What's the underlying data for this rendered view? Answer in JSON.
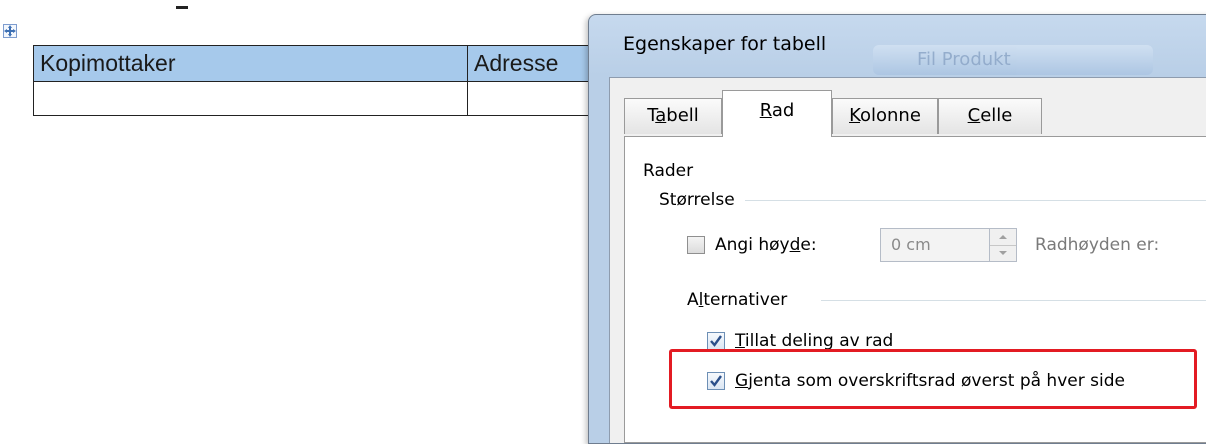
{
  "document": {
    "table": {
      "header": [
        "Kopimottaker",
        "Adresse"
      ],
      "rows": [
        [
          "",
          ""
        ]
      ]
    }
  },
  "dialog": {
    "title": "Egenskaper for tabell",
    "background_tab": "Fil  Produkt",
    "tabs": [
      {
        "pre": "T",
        "u": "a",
        "post": "bell",
        "active": false
      },
      {
        "pre": "",
        "u": "R",
        "post": "ad",
        "active": true
      },
      {
        "pre": "",
        "u": "K",
        "post": "olonne",
        "active": false
      },
      {
        "pre": "",
        "u": "C",
        "post": "elle",
        "active": false
      }
    ],
    "section_title": "Rader",
    "size_group": {
      "label": "Størrelse",
      "height_checkbox": {
        "pre": "Angi høy",
        "u": "d",
        "post": "e:",
        "checked": false
      },
      "height_value": "0 cm",
      "row_height_label": "Radhøyden er:"
    },
    "alternatives_group": {
      "label_pre": "A",
      "label_u": "l",
      "label_post": "ternativer",
      "allow_split": {
        "u": "T",
        "post": "illat deling av rad",
        "checked": true
      },
      "repeat_header": {
        "u": "G",
        "post": "jenta som overskriftsrad øverst på hver side",
        "checked": true
      }
    }
  },
  "colors": {
    "header_fill": "#a6c9eb",
    "highlight": "#e31b23",
    "dialog_frame": "#b9cfe7"
  }
}
